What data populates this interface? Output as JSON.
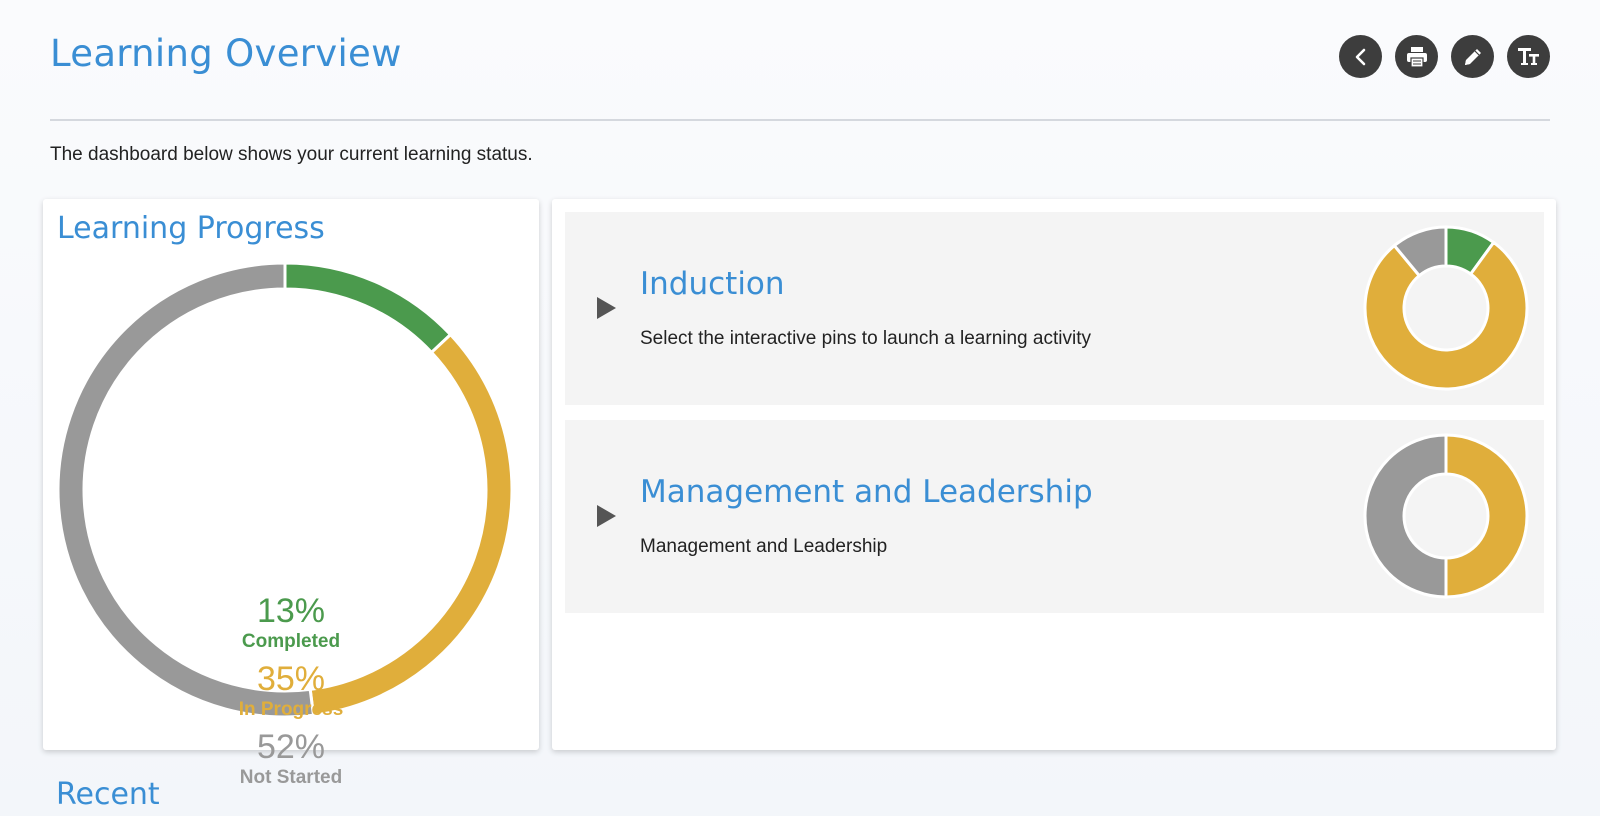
{
  "header": {
    "title": "Learning Overview",
    "toolbar": [
      {
        "name": "back-button",
        "icon": "chevron-left-icon"
      },
      {
        "name": "print-button",
        "icon": "printer-icon"
      },
      {
        "name": "edit-button",
        "icon": "pencil-icon"
      },
      {
        "name": "text-size-button",
        "icon": "text-size-icon"
      }
    ]
  },
  "intro": "The dashboard below shows your current learning status.",
  "progress": {
    "title": "Learning Progress",
    "stats": [
      {
        "value": "13%",
        "label": "Completed",
        "percent": 13,
        "color": "#4b9a4d"
      },
      {
        "value": "35%",
        "label": "In Progress",
        "percent": 35,
        "color": "#e0ae3b"
      },
      {
        "value": "52%",
        "label": "Not Started",
        "percent": 52,
        "color": "#999999"
      }
    ]
  },
  "courses": [
    {
      "title": "Induction",
      "description": "Select the interactive pins to launch a learning activity",
      "segments": [
        {
          "status": "Completed",
          "percent": 10,
          "color": "#4b9a4d"
        },
        {
          "status": "In Progress",
          "percent": 79,
          "color": "#e0ae3b"
        },
        {
          "status": "Not Started",
          "percent": 11,
          "color": "#999999"
        }
      ]
    },
    {
      "title": "Management and Leadership",
      "description": "Management and Leadership",
      "segments": [
        {
          "status": "Completed",
          "percent": 0,
          "color": "#4b9a4d"
        },
        {
          "status": "In Progress",
          "percent": 50,
          "color": "#e0ae3b"
        },
        {
          "status": "Not Started",
          "percent": 50,
          "color": "#999999"
        }
      ]
    }
  ],
  "recent": {
    "title": "Recent"
  }
}
